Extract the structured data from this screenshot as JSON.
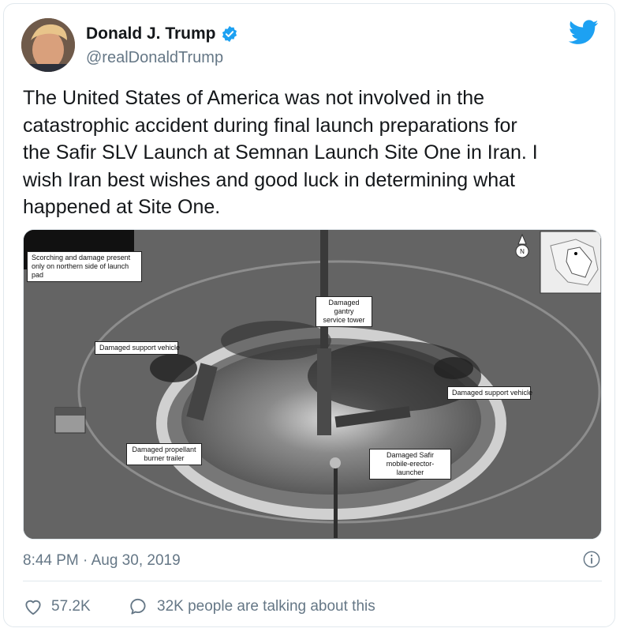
{
  "author": {
    "name": "Donald J. Trump",
    "handle": "@realDonaldTrump",
    "verified": true
  },
  "tweet": {
    "text": "The United States of America was not involved in the\ncatastrophic accident during final launch preparations for\nthe Safir SLV Launch at Semnan Launch Site One in Iran. I\nwish Iran best wishes and good luck in determining what\nhappened at Site One."
  },
  "media": {
    "labels": {
      "scorching": "Scorching and damage present\nonly on northern side of launch pad",
      "gantry": "Damaged gantry\nservice tower",
      "support_left": "Damaged support vehicle",
      "support_right": "Damaged support vehicle",
      "trailer": "Damaged propellant\nburner trailer",
      "safir": "Damaged Safir\nmobile-erector-launcher"
    },
    "compass_label": "N"
  },
  "timestamp": "8:44 PM · Aug 30, 2019",
  "actions": {
    "likes": "57.2K",
    "talking": "32K people are talking about this"
  },
  "colors": {
    "brand": "#1da1f2",
    "text": "#14171a",
    "secondary": "#657786",
    "border": "#e1e8ed"
  }
}
